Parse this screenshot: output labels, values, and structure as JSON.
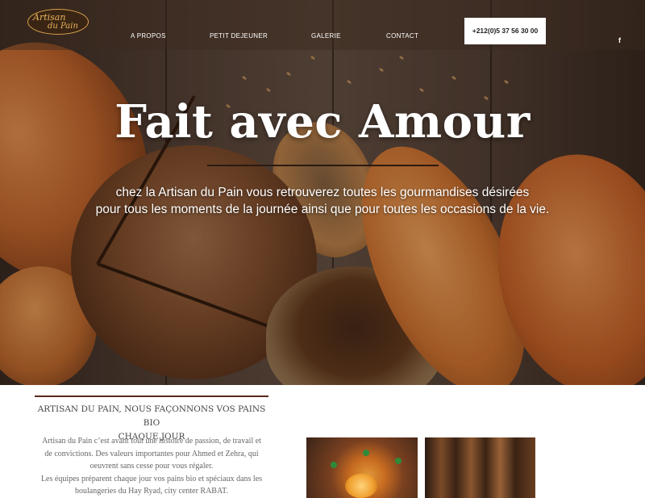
{
  "header": {
    "logo": {
      "line1": "Artisan",
      "line2": "du Pain"
    },
    "nav": [
      {
        "label": "A PROPOS"
      },
      {
        "label": "PETIT DEJEUNER"
      },
      {
        "label": "GALERIE"
      },
      {
        "label": "CONTACT"
      }
    ],
    "phone": "+212(0)5 37 56 30 00",
    "social_icon": "facebook-icon",
    "social_glyph": "f"
  },
  "hero": {
    "title": "Fait avec Amour",
    "subtitle_line1": "chez la Artisan du Pain vous retrouverez toutes les gourmandises désirées",
    "subtitle_line2": "pour tous les moments de la journée ainsi que pour toutes les occasions de la vie."
  },
  "about": {
    "title_line1": "ARTISAN DU PAIN, NOUS FAÇONNONS VOS PAINS BIO",
    "title_line2": "CHAQUE JOUR",
    "body": [
      "Artisan du Pain c’est avant tout une histoire de passion, de travail et",
      "de convictions. Des valeurs importantes pour Ahmed et Zehra, qui",
      "oeuvrent sans cesse pour vous régaler.",
      "Les équipes préparent chaque jour vos pains bio et spéciaux dans les",
      "boulangeries du Hay Ryad, city center RABAT."
    ]
  },
  "colors": {
    "accent_rule": "#5a2a1a",
    "logo_gold": "#d9a14a"
  }
}
